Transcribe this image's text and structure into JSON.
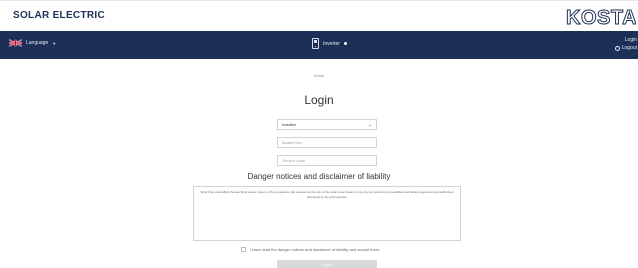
{
  "header": {
    "brand": "SOLAR ELECTRIC",
    "logo": "KOSTAL"
  },
  "navbar": {
    "language": "Language",
    "device_name": "Inverter",
    "login_label": "Login",
    "login_status": "Logout"
  },
  "breadcrumb": "Home",
  "page_title": "Login",
  "form": {
    "role_selected": "Installer",
    "user_placeholder": "Master Key",
    "code_placeholder": "Service code"
  },
  "danger": {
    "title": "Danger notices and disclaimer of liability",
    "text": "Work that could affect the electrical power system of the respective grid operator at the site of the solar power feed-in may only be carried out by qualified electricians approved and authorised (licensed) by the grid operator."
  },
  "accept_text": "I have read the danger notices and disclaimer of liability and accept them.",
  "login_button": "Login",
  "colors": {
    "navbar": "#1c2f57",
    "brand": "#1c2f55",
    "button_disabled": "#d7d9dd"
  }
}
